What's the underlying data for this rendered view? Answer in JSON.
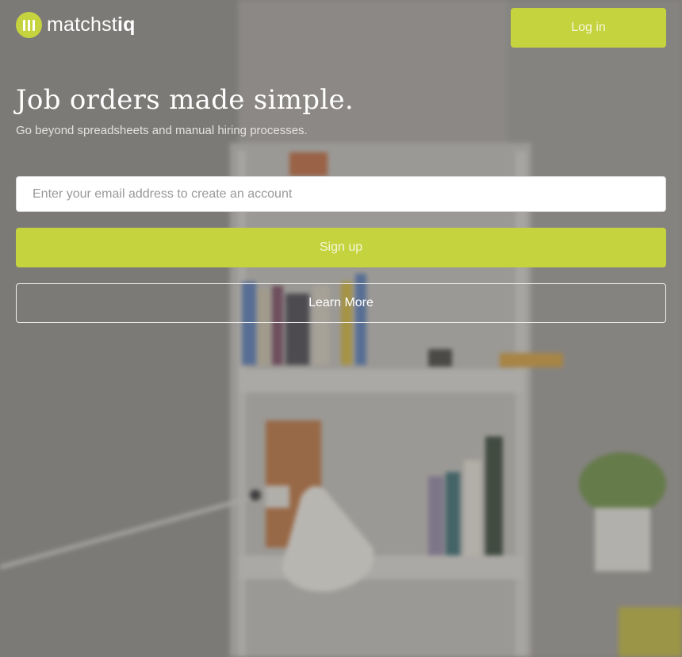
{
  "brand": {
    "name_light": "matchst",
    "name_bold": "iq",
    "accent_color": "#c5d33e"
  },
  "header": {
    "login_label": "Log in"
  },
  "hero": {
    "title": "Job orders made simple.",
    "subtitle": "Go beyond spreadsheets and manual hiring processes."
  },
  "signup_form": {
    "email_placeholder": "Enter your email address to create an account",
    "email_value": "",
    "signup_label": "Sign up",
    "learn_more_label": "Learn More"
  },
  "icons": {
    "logo": "logo-mark-icon"
  }
}
